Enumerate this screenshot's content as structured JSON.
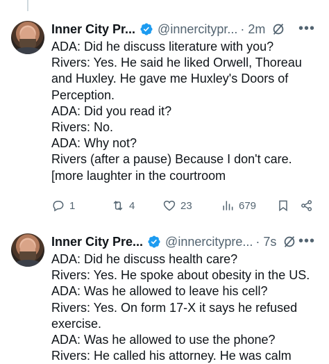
{
  "tweet1": {
    "name": "Inner City Pr...",
    "handle": "@innercitypr...",
    "time": "· 2m",
    "lines": [
      "ADA: Did he discuss literature with you?",
      "Rivers: Yes. He said he liked Orwell, Thoreau",
      "and Huxley. He gave me Huxley's Doors of",
      "Perception.",
      "ADA: Did you read it?",
      "Rivers: No.",
      "ADA: Why not?",
      "Rivers (after a pause) Because I don't care.",
      "[more laughter in the courtroom"
    ],
    "replies": "1",
    "reposts": "4",
    "likes": "23",
    "views": "679"
  },
  "tweet2": {
    "name": "Inner City Pre...",
    "handle": "@innercitypre...",
    "time": "· 7s",
    "lines": [
      "ADA: Did he discuss health care?",
      "Rivers: Yes. He spoke about obesity in the US.",
      "ADA: Was he allowed to leave his cell?",
      "Rivers: Yes. On form 17-X it says he refused",
      "exercise.",
      "ADA: Was he allowed to use the phone?",
      "Rivers: He called his attorney. He was calm"
    ]
  },
  "icons": {
    "more": "•••"
  },
  "colors": {
    "verified": "#1d9bf0",
    "secondary": "#536471",
    "text": "#0f1419"
  }
}
